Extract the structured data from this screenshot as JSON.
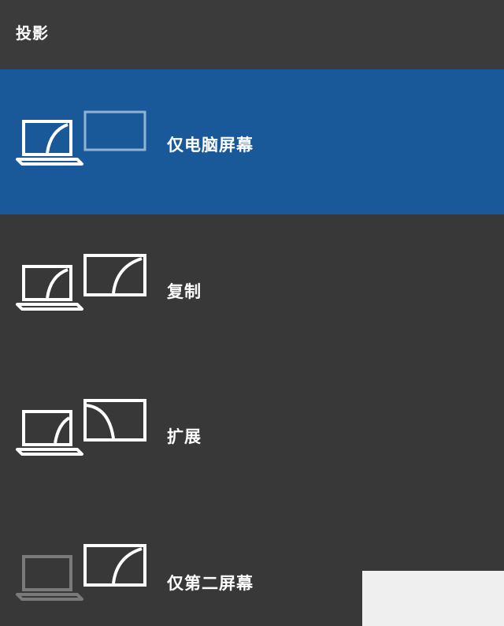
{
  "header": {
    "title": "投影"
  },
  "options": [
    {
      "label": "仅电脑屏幕",
      "icon": "pc-screen-only-icon",
      "selected": true
    },
    {
      "label": "复制",
      "icon": "duplicate-icon",
      "selected": false
    },
    {
      "label": "扩展",
      "icon": "extend-icon",
      "selected": false
    },
    {
      "label": "仅第二屏幕",
      "icon": "second-screen-only-icon",
      "selected": false
    }
  ],
  "colors": {
    "selected_bg": "#19599a",
    "panel_bg": "#383838",
    "icon_active": "#ffffff",
    "icon_dim": "#7a7a7a",
    "icon_dim_blue": "#8fb3d6"
  }
}
